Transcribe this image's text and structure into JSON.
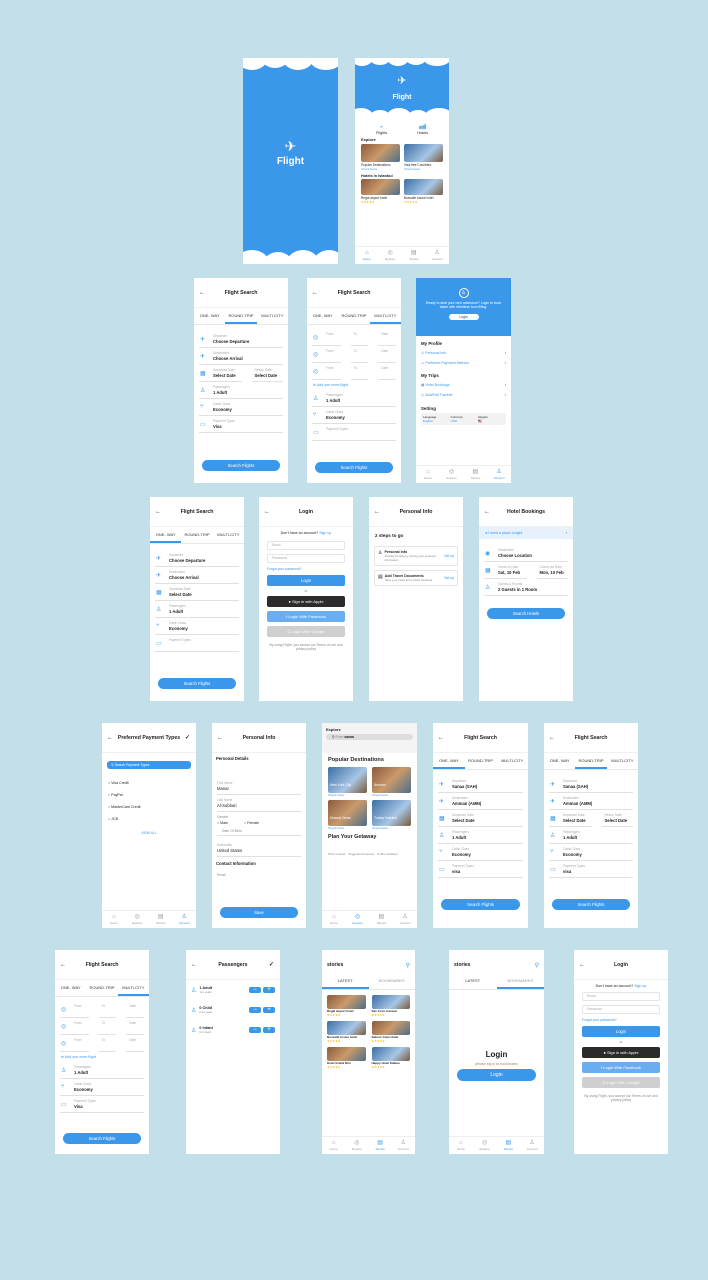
{
  "colors": {
    "background": "#c3dfe9",
    "accent": "#3b97e9",
    "white": "#ffffff"
  },
  "splash": {
    "title": "Flight"
  },
  "home": {
    "title": "Flight",
    "cats": [
      "Flights",
      "Hotels"
    ],
    "explore": "Explore",
    "explore_items": [
      {
        "title": "Popular Destinations",
        "link": "Check fares"
      },
      {
        "title": "Visa free Countries",
        "link": "Check fares"
      }
    ],
    "hotels_title": "Hotels in Istanbul",
    "hotels": [
      "Regal airport hotel",
      "Bosvalle house hotel"
    ],
    "nav": [
      "Home",
      "Explore",
      "Stories",
      "Account"
    ]
  },
  "search": {
    "title": "Flight Search",
    "tabs": [
      "ONE- WAY",
      "ROUND-TRIP",
      "MULTI-CITY"
    ],
    "departure_label": "Departure",
    "departure": "Choose Departure",
    "departure_short": "Choose Departure",
    "arrival_label": "Destination",
    "arrival": "Choose Arrival",
    "date_label": "Departure Date",
    "date": "Select Date",
    "return_label": "Return Date",
    "return": "Select Date",
    "pass_label": "Passengers",
    "pass": "1 Adult",
    "class_label": "Cabin Class",
    "class": "Economy",
    "pay_label": "Payment Types",
    "pay": "Visa",
    "button": "Search Flights",
    "from": "From",
    "to": "To",
    "date_short": "Date",
    "add_flight": "Add one more flight",
    "filled_from": "Sanaa (SAH)",
    "filled_to": "Amman (AMM)",
    "filled_pay": "visa"
  },
  "account": {
    "banner": "Ready to start your next adventure? Login to book faster with effortless from filling.",
    "login_btn": "Login",
    "my_profile": "My Profile",
    "profile_items": [
      "Personal Info",
      "Preferred Payment Method"
    ],
    "my_trips": "My Trips",
    "trip_items": [
      "Hotel Bookings",
      "Add/Edit Traveler"
    ],
    "setting": "Setting",
    "settings": [
      {
        "label": "Language",
        "value": "English"
      },
      {
        "label": "Currency",
        "value": "USD"
      },
      {
        "label": "Region",
        "value": "🇺🇸"
      }
    ]
  },
  "login": {
    "title": "Login",
    "no_account": "Don't have an account?",
    "signup": "Sign up",
    "email": "Email",
    "password": "Password",
    "forgot": "Forgot your password?",
    "login": "Login",
    "or": "or",
    "apple": "Sign in with Apple",
    "facebook": "Login With Facebook",
    "google": "Login With Google",
    "terms": "By using Flight, you accept our Terms of use and privacy policy"
  },
  "personal_steps": {
    "title": "Personal Info",
    "steps": "2 steps to go",
    "items": [
      {
        "title": "Personal Info",
        "desc": "Simplify booking by storing your personal information",
        "action": "Set up"
      },
      {
        "title": "Add Travel Documents",
        "desc": "Save your travel ID for faster bookings",
        "action": "Set up"
      }
    ]
  },
  "hotel_bookings": {
    "title": "Hotel Bookings",
    "need": "I need a place tonight",
    "dest_label": "Destination",
    "dest": "Choose Location",
    "checkin_label": "Check-in Date",
    "checkin": "Sat, 10 Feb",
    "checkout_label": "Check-out Date",
    "checkout": "Mon, 10 Feb",
    "guests_label": "Guests & Rooms",
    "guests": "2 Guests in 1 Room",
    "button": "Search Hotels"
  },
  "payment": {
    "title": "Preferred Payment Types",
    "search": "Search Payment Types",
    "options": [
      "Visa Credit",
      "PayPal",
      "MasterCard Credit",
      "JCB"
    ],
    "view_all": "VIEW ALL"
  },
  "personal_form": {
    "title": "Personal Info",
    "section": "Personal Details",
    "first_label": "First Name",
    "first": "Manar",
    "last_label": "Last Name",
    "last": "Al-Subbari",
    "gender": "Gender",
    "male": "Male",
    "female": "Female",
    "dob": "Date Of Birth",
    "nationality_label": "Nationality",
    "nationality": "United States",
    "contact": "Contact Information",
    "email": "Email",
    "save": "Save"
  },
  "explore": {
    "title": "Explore",
    "search_from": "From",
    "search_val": "sanaa",
    "popular": "Popular Destinations",
    "cities": [
      {
        "name": "New York City",
        "link": "Check fares"
      },
      {
        "name": "Amman",
        "link": "Check fares"
      },
      {
        "name": "Muscat Oman",
        "link": "Check fares"
      },
      {
        "name": "Turkey Istanbul",
        "link": "Check fares"
      }
    ],
    "getaway": "Plan Your Getaway",
    "chips": [
      "Price Lowest",
      "Suggested Itinerary",
      "Public Holidays"
    ]
  },
  "passengers": {
    "title": "Passengers",
    "items": [
      {
        "count": "1 Adult",
        "sub": "12+ years"
      },
      {
        "count": "0 Child",
        "sub": "2-11 years"
      },
      {
        "count": "0 Infant",
        "sub": "0-2 years"
      }
    ]
  },
  "stories": {
    "title": "stories",
    "tabs": [
      "LATEST",
      "BOOKMARKS"
    ],
    "cards": [
      "Regal airport hotel",
      "San Coco Cancun",
      "Bosvalle house hotel",
      "Saboor Cave Hotel",
      "Hotel Grand Rim",
      "Happy Hotel Kalkan"
    ]
  },
  "bookmarks": {
    "title": "stories",
    "tabs": [
      "LATEST",
      "BOOKMARKS"
    ],
    "login_title": "Login",
    "login_sub": "please log in to bookmarks",
    "login_btn": "Login"
  }
}
